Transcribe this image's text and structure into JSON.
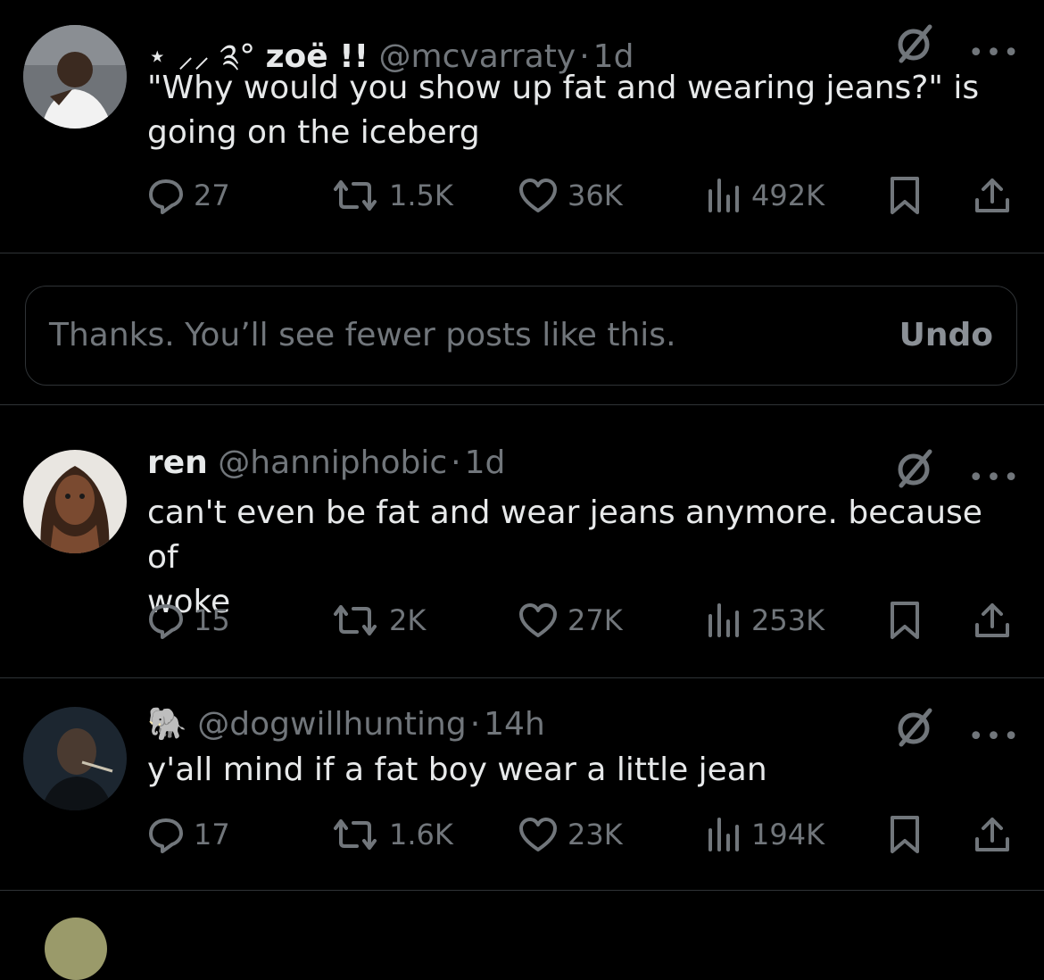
{
  "posts": [
    {
      "prefix": "⋆ ⸝⸝ ༉°",
      "name": "zoë !!",
      "handle": "@mcvarraty",
      "dot": "·",
      "time": "1d",
      "text": "\"Why would you show up fat and wearing jeans?\" is\ngoing on the iceberg",
      "replies": "27",
      "reposts": "1.5K",
      "likes": "36K",
      "views": "492K",
      "avatar_icon": "person-photo"
    },
    {
      "prefix": "",
      "name": "ren",
      "handle": "@hanniphobic",
      "dot": "·",
      "time": "1d",
      "text": "can't even be fat and wear jeans anymore. because of\nwoke",
      "replies": "15",
      "reposts": "2K",
      "likes": "27K",
      "views": "253K",
      "avatar_icon": "person-photo"
    },
    {
      "prefix": "🐘",
      "name": "",
      "handle": "@dogwillhunting",
      "dot": "·",
      "time": "14h",
      "text": "y'all mind if a fat boy wear a little jean",
      "replies": "17",
      "reposts": "1.6K",
      "likes": "23K",
      "views": "194K",
      "avatar_icon": "person-photo"
    }
  ],
  "notice": {
    "text": "Thanks. You’ll see fewer posts like this.",
    "undo_label": "Undo"
  },
  "more_glyph": "•••",
  "colors": {
    "background": "#000000",
    "text": "#e7e9ea",
    "muted": "#71767b",
    "divider": "#2f3336"
  }
}
